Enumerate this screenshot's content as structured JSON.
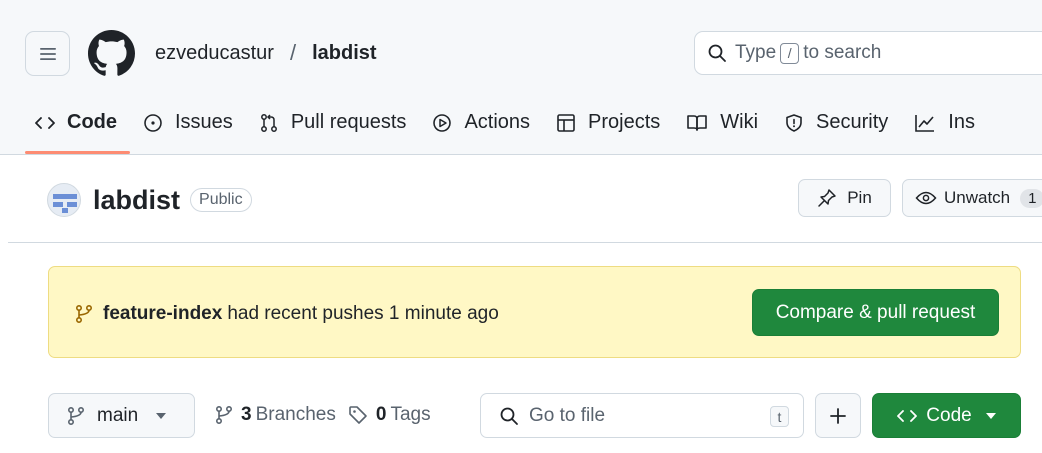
{
  "header": {
    "owner": "ezveducastur",
    "separator": "/",
    "repo": "labdist",
    "search_prefix": "Type",
    "search_key": "/",
    "search_suffix": "to search"
  },
  "tabs": [
    {
      "label": "Code",
      "icon": "code-icon",
      "active": true
    },
    {
      "label": "Issues",
      "icon": "issue-icon"
    },
    {
      "label": "Pull requests",
      "icon": "pull-request-icon"
    },
    {
      "label": "Actions",
      "icon": "play-icon"
    },
    {
      "label": "Projects",
      "icon": "table-icon"
    },
    {
      "label": "Wiki",
      "icon": "book-icon"
    },
    {
      "label": "Security",
      "icon": "shield-icon"
    },
    {
      "label": "Ins",
      "icon": "graph-icon"
    }
  ],
  "repo": {
    "name": "labdist",
    "visibility": "Public",
    "pin_label": "Pin",
    "unwatch_label": "Unwatch",
    "watch_count": "1"
  },
  "banner": {
    "branch": "feature-index",
    "message": "had recent pushes 1 minute ago",
    "button_label": "Compare & pull request"
  },
  "toolbar": {
    "branch": "main",
    "branches_count": "3",
    "branches_label": "Branches",
    "tags_count": "0",
    "tags_label": "Tags",
    "go_to_file_placeholder": "Go to file",
    "go_to_file_key": "t",
    "code_button_label": "Code"
  },
  "colors": {
    "primary_button": "#1f883d",
    "banner_bg": "#fff8c5",
    "active_tab_underline": "#fd8c73",
    "header_bg": "#f6f8fa"
  }
}
